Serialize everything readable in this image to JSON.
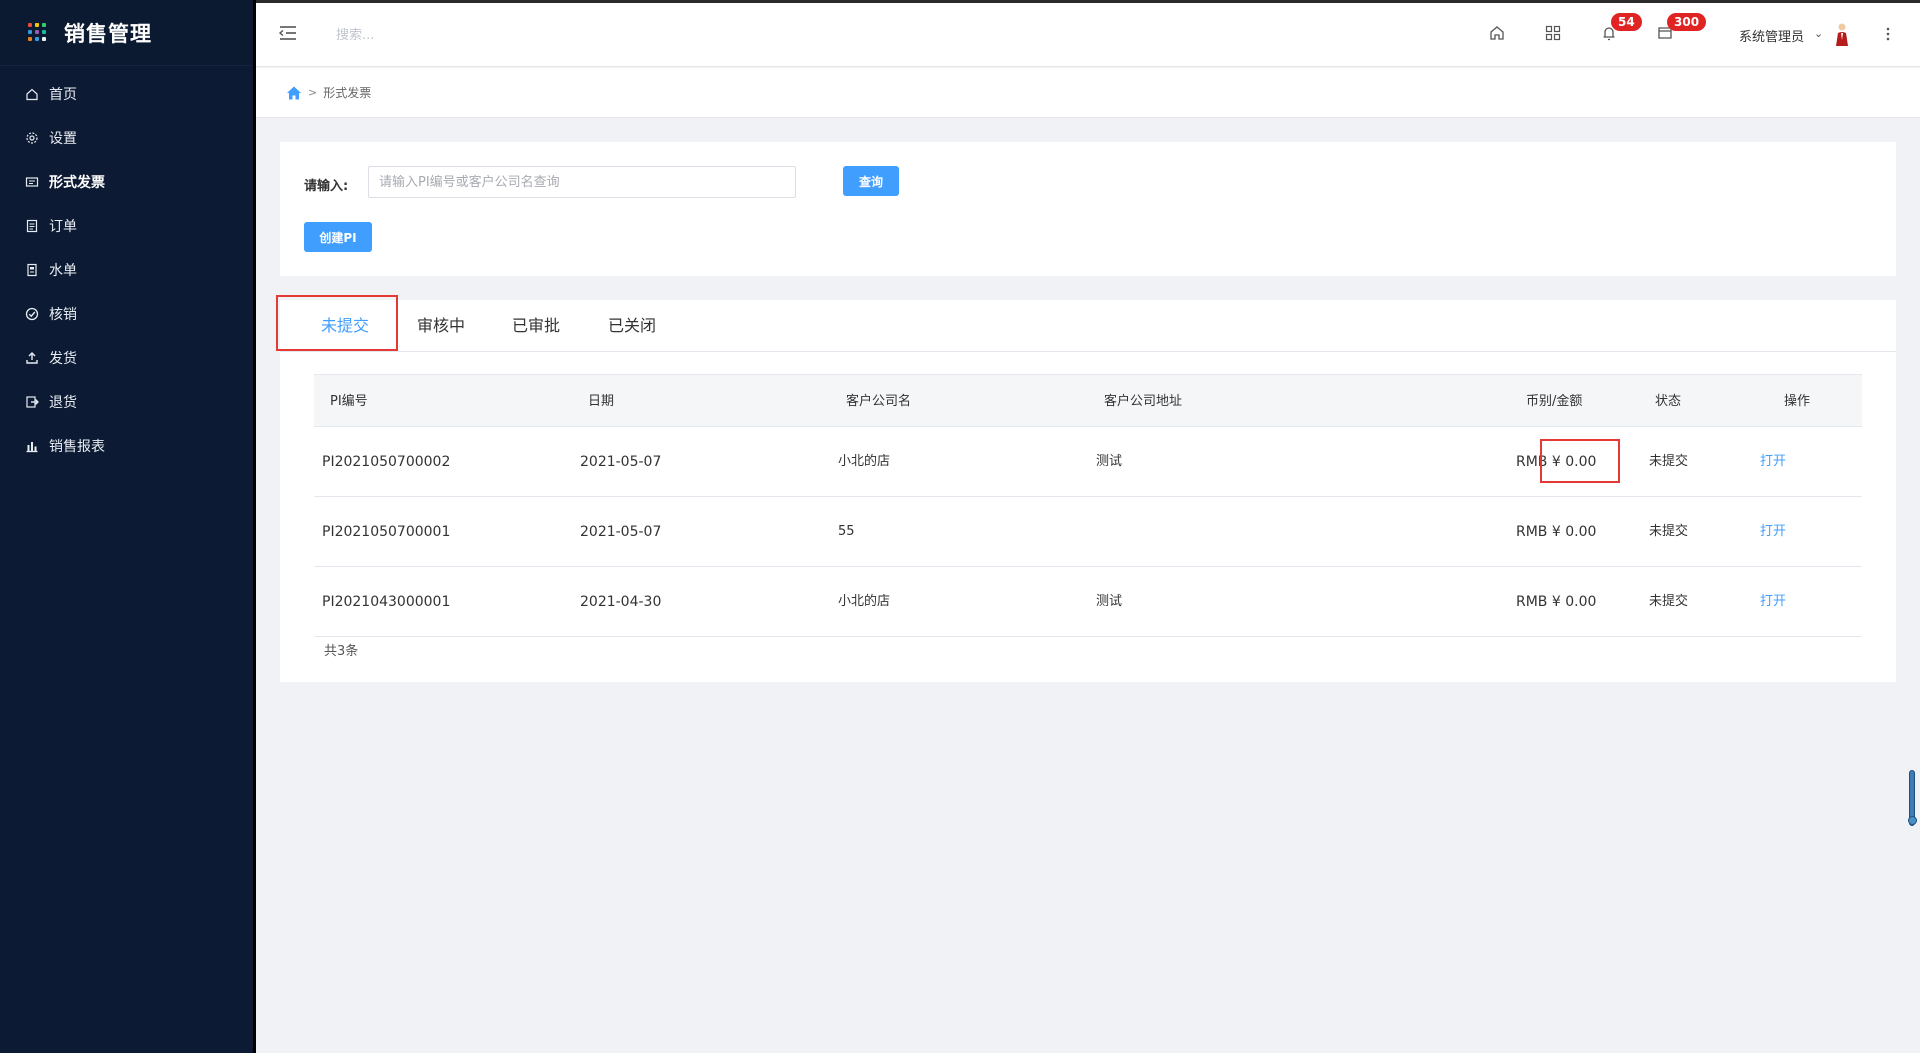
{
  "app": {
    "title": "销售管理",
    "brand_dot_colors": [
      "#e74c3c",
      "#f1c40f",
      "#2ecc71",
      "#3498db",
      "#9b59b6",
      "#1abc9c",
      "#e67e22",
      "#3498db",
      "#ecf0f1"
    ]
  },
  "sidebar": {
    "items": [
      {
        "label": "首页",
        "icon": "home-icon"
      },
      {
        "label": "设置",
        "icon": "gear-icon"
      },
      {
        "label": "形式发票",
        "icon": "invoice-icon"
      },
      {
        "label": "订单",
        "icon": "order-icon"
      },
      {
        "label": "水单",
        "icon": "receipt-icon"
      },
      {
        "label": "核销",
        "icon": "check-circle-icon"
      },
      {
        "label": "发货",
        "icon": "upload-icon"
      },
      {
        "label": "退货",
        "icon": "return-icon"
      },
      {
        "label": "销售报表",
        "icon": "bar-chart-icon"
      }
    ]
  },
  "header": {
    "search_placeholder": "搜索...",
    "notifications_count": "54",
    "messages_count": "300",
    "user_name": "系统管理员"
  },
  "breadcrumb": {
    "current": "形式发票"
  },
  "search": {
    "label": "请输入:",
    "placeholder": "请输入PI编号或客户公司名查询",
    "value": "",
    "query_button": "查询",
    "create_button": "创建PI"
  },
  "tabs": [
    {
      "label": "未提交",
      "active": true
    },
    {
      "label": "审核中",
      "active": false
    },
    {
      "label": "已审批",
      "active": false
    },
    {
      "label": "已关闭",
      "active": false
    }
  ],
  "table": {
    "headers": {
      "pi_no": "PI编号",
      "date": "日期",
      "company": "客户公司名",
      "address": "客户公司地址",
      "amount": "币别/金额",
      "status": "状态",
      "action": "操作"
    },
    "rows": [
      {
        "pi_no": "PI2021050700002",
        "date": "2021-05-07",
        "company": "小北的店",
        "address": "测试",
        "amount": "RMB ¥ 0.00",
        "status": "未提交",
        "action": "打开"
      },
      {
        "pi_no": "PI2021050700001",
        "date": "2021-05-07",
        "company": "55",
        "address": "",
        "amount": "RMB ¥ 0.00",
        "status": "未提交",
        "action": "打开"
      },
      {
        "pi_no": "PI2021043000001",
        "date": "2021-04-30",
        "company": "小北的店",
        "address": "测试",
        "amount": "RMB ¥ 0.00",
        "status": "未提交",
        "action": "打开"
      }
    ],
    "total": "共3条"
  },
  "colors": {
    "primary": "#409eff",
    "sidebar_bg": "#0c1b33",
    "highlight_border": "#e53935",
    "badge": "#e02424"
  }
}
